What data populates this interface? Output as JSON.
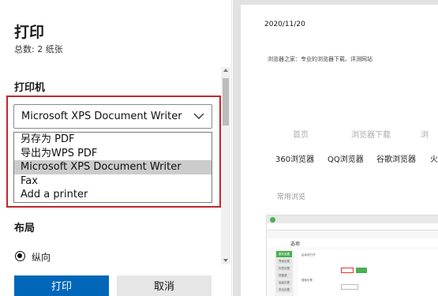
{
  "panel": {
    "title": "打印",
    "subtitle": "总数: 2 纸张",
    "printer_label": "打印机",
    "printer_selected": "Microsoft XPS Document Writer",
    "printer_options": [
      "另存为 PDF",
      "导出为WPS PDF",
      "Microsoft XPS Document Writer",
      "Fax",
      "Add a printer"
    ],
    "printer_highlighted_index": 2,
    "layout_label": "布局",
    "layout_option": "纵向",
    "print_button": "打印",
    "cancel_button": "取消"
  },
  "preview": {
    "date": "2020/11/20",
    "site_title": "浏览器之家：专业的浏览器下载、评测网站",
    "nav": [
      "首页",
      "浏览器下载",
      "浏"
    ],
    "links": [
      "360浏览器",
      "QQ浏览器",
      "谷歌浏览器",
      "火"
    ],
    "common": "常用浏览",
    "thumbnail": {
      "menu_title": "选项",
      "side_items": [
        "基本设置",
        "界面设置",
        "标签设置",
        "快捷键",
        "高级设置",
        "安全设置"
      ],
      "row1": "启动时打开",
      "row2": "搜索引擎"
    }
  },
  "colors": {
    "accent_blue": "#0067b8",
    "highlight_red": "#c0282d",
    "selected_option_bg": "#cccccc"
  }
}
